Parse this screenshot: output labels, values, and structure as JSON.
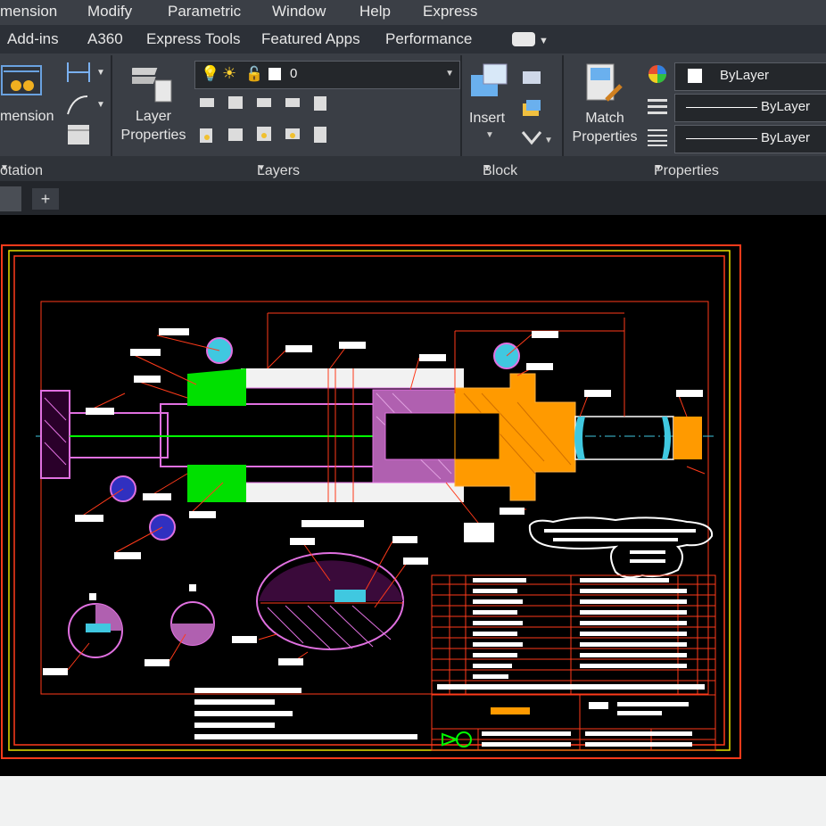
{
  "menu": [
    "mension",
    "Modify",
    "Parametric",
    "Window",
    "Help",
    "Express"
  ],
  "ribbon_tabs": [
    "Add-ins",
    "A360",
    "Express Tools",
    "Featured Apps",
    "Performance"
  ],
  "panels": {
    "annotation": {
      "dimension_label": "mension",
      "title": "otation"
    },
    "layers": {
      "properties_label_1": "Layer",
      "properties_label_2": "Properties",
      "layer_value": "0",
      "title": "Layers"
    },
    "block": {
      "insert_label": "Insert",
      "title": "Block"
    },
    "properties": {
      "match_label_1": "Match",
      "match_label_2": "Properties",
      "color_value": "ByLayer",
      "linetype_value": "ByLayer",
      "lineweight_value": "ByLayer",
      "title": "Properties"
    }
  },
  "colors": {
    "frame": "#ff3a1a",
    "border": "#e8e000",
    "magenta": "#e070e0",
    "green": "#00ff00",
    "orange": "#ff9a00",
    "cyan": "#40c8e0",
    "white": "#ffffff"
  }
}
